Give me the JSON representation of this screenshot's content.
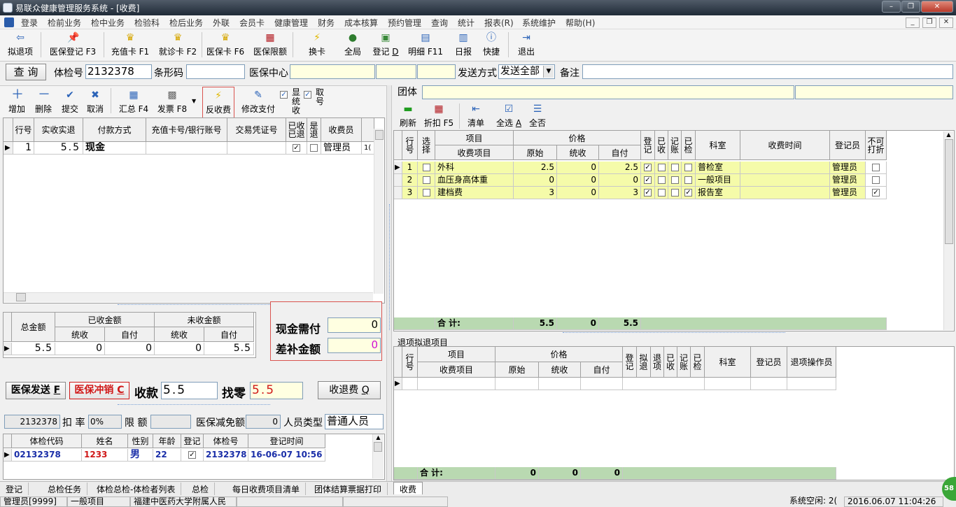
{
  "window": {
    "title": "易联众健康管理服务系统 - [收费]"
  },
  "menu": [
    "登录",
    "检前业务",
    "检中业务",
    "检验科",
    "检后业务",
    "外联",
    "会员卡",
    "健康管理",
    "财务",
    "成本核算",
    "预约管理",
    "查询",
    "统计",
    "报表(R)",
    "系统维护",
    "帮助(H)"
  ],
  "toolbar": {
    "buttons": [
      "拟退项",
      "医保登记 F3",
      "充值卡 F1",
      "就诊卡 F2",
      "医保卡 F6",
      "医保限额",
      "换卡",
      "全局",
      "登记",
      "明细 F11",
      "日报",
      "快捷",
      "退出"
    ],
    "dengji_hotkey": "D"
  },
  "search": {
    "query_btn": "查 询",
    "exam_no_label": "体检号",
    "exam_no": "2132378",
    "barcode_label": "条形码",
    "barcode": "",
    "medins_label": "医保中心",
    "send_mode_label": "发送方式",
    "send_mode": "发送全部",
    "remark_label": "备注",
    "remark": ""
  },
  "left_tools": {
    "add": "增加",
    "delete": "删除",
    "submit": "提交",
    "cancel": "取消",
    "summary": "汇总 F4",
    "invoice": "发票 F8",
    "reverse": "反收费",
    "modify_pay": "修改支付",
    "show_received": "显统收",
    "fetch_no": "取号"
  },
  "payment_grid": {
    "headers": [
      "行号",
      "实收实退",
      "付款方式",
      "充值卡号/银行账号",
      "交易凭证号",
      "已收已退",
      "是退",
      "收费员"
    ],
    "rows": [
      {
        "no": "1",
        "amount": "5.5",
        "method": "现金",
        "card": "",
        "voucher": "",
        "received": "✓",
        "refund": "",
        "cashier": "管理员",
        "extra": "1("
      }
    ]
  },
  "totals": {
    "total_label": "总金额",
    "received_label": "已收金额",
    "unreceived_label": "未收金额",
    "sub_pooled": "统收",
    "sub_self": "自付",
    "total": "5.5",
    "recv_pooled": "0",
    "recv_self": "0",
    "unrecv_pooled": "0",
    "unrecv_self": "5.5"
  },
  "cash": {
    "need_label": "现金需付",
    "need": "0",
    "diff_label": "差补金额",
    "diff": "0"
  },
  "actions": {
    "mi_send": "医保发送",
    "mi_send_key": "F",
    "mi_reverse": "医保冲销",
    "mi_reverse_key": "C",
    "pay_label": "收款",
    "pay": "5.5",
    "change_label": "找零",
    "change": "5.5",
    "refund": "收退费",
    "refund_key": "Q"
  },
  "info": {
    "exam_no": "2132378",
    "discount_label": "扣 率",
    "discount": "0%",
    "limit_label": "限 额",
    "limit": "",
    "mi_reduce_label": "医保减免额",
    "mi_reduce": "0",
    "person_type_label": "人员类型",
    "person_type": "普通人员"
  },
  "patient_grid": {
    "headers": [
      "体检代码",
      "姓名",
      "性别",
      "年龄",
      "登记",
      "体检号",
      "登记时间"
    ],
    "rows": [
      {
        "code": "02132378",
        "name": "1233",
        "sex": "男",
        "age": "22",
        "reg": "✓",
        "exam_no": "2132378",
        "time": "16-06-07 10:56"
      }
    ]
  },
  "group": {
    "label": "团体",
    "value": ""
  },
  "right_tools": {
    "refresh": "刷新",
    "discount": "折扣 F5",
    "list": "清单",
    "select_all": "全选",
    "select_all_key": "A",
    "select_none": "全否"
  },
  "items_grid": {
    "headers": {
      "no": "行号",
      "select": "选择",
      "item": "项目",
      "fee_item": "收费项目",
      "price": "价格",
      "orig": "原始",
      "pooled": "统收",
      "self": "自付",
      "reg": "登记",
      "recv": "已收",
      "account": "记账",
      "checked": "已检",
      "dept": "科室",
      "fee_time": "收费时间",
      "registrar": "登记员",
      "no_print": "不可打折"
    },
    "rows": [
      {
        "no": "1",
        "name": "外科",
        "orig": "2.5",
        "pooled": "0",
        "self": "2.5",
        "reg": true,
        "recv": false,
        "account": false,
        "checked": false,
        "dept": "普检室",
        "time": "",
        "registrar": "管理员",
        "no_print": false
      },
      {
        "no": "2",
        "name": "血压身高体重",
        "orig": "0",
        "pooled": "0",
        "self": "0",
        "reg": true,
        "recv": false,
        "account": false,
        "checked": false,
        "dept": "一般项目",
        "time": "",
        "registrar": "管理员",
        "no_print": false
      },
      {
        "no": "3",
        "name": "建档费",
        "orig": "3",
        "pooled": "0",
        "self": "3",
        "reg": true,
        "recv": false,
        "account": false,
        "checked": true,
        "dept": "报告室",
        "time": "",
        "registrar": "管理员",
        "no_print": true
      }
    ],
    "sum_label": "合  计:",
    "sum_orig": "5.5",
    "sum_pooled": "0",
    "sum_self": "5.5"
  },
  "refund_items": {
    "title": "退项拟退项目",
    "headers": {
      "no": "行号",
      "item": "项目",
      "fee_item": "收费项目",
      "price": "价格",
      "orig": "原始",
      "pooled": "统收",
      "self": "自付",
      "reg": "登记",
      "pending": "拟退",
      "refund": "退项",
      "recv": "已收",
      "account": "记账",
      "checked": "已检",
      "dept": "科室",
      "registrar": "登记员",
      "operator": "退项操作员"
    },
    "sum_label": "合  计:",
    "sum_orig": "0",
    "sum_pooled": "0",
    "sum_self": "0"
  },
  "tabs": [
    "登记",
    "总检任务",
    "体检总检-体检者列表",
    "总检",
    "每日收费项目清单",
    "团体结算票据打印",
    "收费"
  ],
  "status": {
    "user": "管理员[9999]",
    "dept": "一般项目",
    "org": "福建中医药大学附属人民",
    "sys_label": "系统空闲:",
    "sys_val": "2(",
    "datetime": "2016.06.07 11:04:26",
    "badge": "58"
  }
}
